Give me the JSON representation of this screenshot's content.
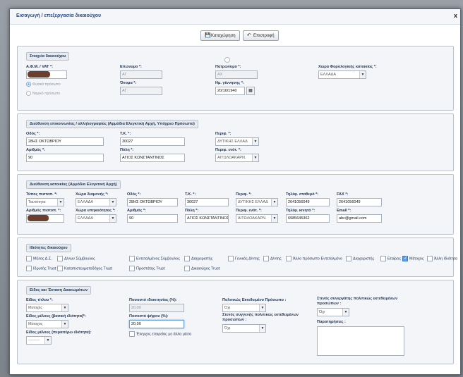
{
  "dialog": {
    "title": "Εισαγωγή / επεξεργασία δικαιούχου",
    "close": "x"
  },
  "toolbar": {
    "save_label": "Καταχώρηση",
    "back_label": "Επιστροφή",
    "save_icon": "floppy-icon",
    "back_icon": "return-arrow-icon"
  },
  "beneficiary": {
    "legend": "Στοιχεία δικαιούχου",
    "afm_label": "Α.Φ.Μ. / VAT *:",
    "surname_label": "Επώνυμο *:",
    "surname_value": "ΑΓ",
    "name_label": "Όνομα *:",
    "name_value": "ΑΓ",
    "father_label": "Πατρώνυμο *:",
    "father_value": "ΑΧ",
    "birth_label": "Ημ. γέννησης *:",
    "birth_value": "20/10/1940",
    "tax_country_label": "Χώρα Φορολογικής κατοικίας *:",
    "tax_country_value": "ΕΛΛΑΔΑ",
    "person_natural": "Φυσικό πρόσωπο",
    "person_legal": "Νομικό πρόσωπο"
  },
  "contact_address": {
    "legend": "Διεύθυνση επικοινωνίας / αλληλογραφίας (Αρμόδια Ελεγκτική Αρχή, Υπόχρεο Πρόσωπο)",
    "street_label": "Οδός *:",
    "street_value": "28ΗΣ ΟΚΤΩΒΡΙΟΥ",
    "number_label": "Αριθμός *:",
    "number_value": "90",
    "zip_label": "Τ.Κ. *:",
    "zip_value": "30027",
    "city_label": "Πόλη *:",
    "city_value": "ΑΓΙΟΣ ΚΩΝΣΤΑΝΤΙΝΟΣ",
    "region_label": "Περιφ. *:",
    "region_value": "ΔΥΤΙΚΗΣ ΕΛΛΑΔ",
    "unit_label": "Περιφ. ενότ. *:",
    "unit_value": "ΑΙΤΩΛΟΑΚΑΡΝ."
  },
  "residence_address": {
    "legend": "Διεύθυνση κατοικίας (Αρμόδια Ελεγκτική Αρχή)",
    "id_type_label": "Τύπος πιστοπ. *:",
    "id_type_value": "Ταυτότητα",
    "id_number_label": "Αριθμός πιστοπ. *:",
    "residence_country_label": "Χώρα διαμονής *:",
    "residence_country_value": "ΕΛΛΑΔΑ",
    "citizenship_label": "Χώρα υπηκοότητας *:",
    "citizenship_value": "ΕΛΛΑΔΑ",
    "street_label": "Οδός *:",
    "street_value": "28ΗΣ ΟΚΤΩΒΡΙΟΥ",
    "number_label": "Αριθμός *:",
    "number_value": "90",
    "zip_label": "Τ.Κ. *:",
    "zip_value": "30027",
    "city_label": "Πόλη *:",
    "city_value": "ΑΓΙΟΣ ΚΩΝΣΤΑΝΤΙΝΟΣ",
    "region_label": "Περιφ. *:",
    "region_value": "ΔΥΤΙΚΗΣ ΕΛΛΑΔ",
    "unit_label": "Περιφ. ενότ. *:",
    "unit_value": "ΑΙΤΩΛΟΑΚΑΡΝ.",
    "phone_label": "Τηλέφ. σταθερό *:",
    "phone_value": "2641056049",
    "mobile_label": "Τηλέφ. κινητό *:",
    "mobile_value": "6985645362",
    "fax_label": "FAX *:",
    "fax_value": "2641056049",
    "email_label": "Email *:",
    "email_value": "abc@gmail.com"
  },
  "roles": {
    "legend": "Ιδιότητες δικαιούχου",
    "items": [
      {
        "label": "Μέλος Δ.Σ.",
        "checked": false
      },
      {
        "label": "Δ/νων Σύμβουλος",
        "checked": false
      },
      {
        "label": "Εντεταλμένος Σύμβουλος",
        "checked": false
      },
      {
        "label": "Διαχειριστής",
        "checked": false
      },
      {
        "label": "Γενικός Δ/ντης",
        "checked": false
      },
      {
        "label": "Δ/ντης",
        "checked": false
      },
      {
        "label": "Άλλο πρόσωπο Εντεταλμένο",
        "checked": false
      },
      {
        "label": "Διαχειριστής",
        "checked": false
      },
      {
        "label": "Εταίρος",
        "checked": false
      },
      {
        "label": "Μέτοχος",
        "checked": true
      },
      {
        "label": "Άλλη Ιδιότητα",
        "checked": false
      },
      {
        "label": "Ιδρυτής Trust",
        "checked": false
      },
      {
        "label": "Καταπιστευματοδόχος Trust",
        "checked": false
      },
      {
        "label": "Προστάτης Trust",
        "checked": false
      },
      {
        "label": "Δικαιούχος Trust",
        "checked": false
      }
    ]
  },
  "ownership": {
    "legend": "Είδος και Έκταση Δικαιωμάτων",
    "title_type_label": "Είδος τίτλου *:",
    "title_type_value": "Μετοχές",
    "member_type_label": "Είδος μέλους (βασική ιδιότητα)*:",
    "member_type_value": "Μέτοχος",
    "member_type_extra_label": "Είδος μέλους (περαιτέρω ιδιότητα):",
    "member_type_extra_value": "---------",
    "ownership_pct_label": "Ποσοστό ιδιοκτησίας (%):",
    "ownership_pct_value": "20,00",
    "vote_pct_label": "Ποσοστό ψήφου (%):",
    "vote_pct_value": "20,00",
    "control_label": "Έλεγχος εταιρείας με άλλα μέσα",
    "pep_label": "Πολιτικώς Εκτεθειμένο Πρόσωπο :",
    "pep_value": "Όχι",
    "pep_relative_label": "Στενός συγγενής πολιτικώς εκτεθειμένων προσώπων :",
    "pep_relative_value": "Όχι",
    "pep_associate_label": "Στενός συνεργάτης πολιτικώς εκτεθειμένων προσώπων :",
    "pep_associate_value": "Όχι",
    "notes_label": "Παρατηρήσεις :"
  }
}
